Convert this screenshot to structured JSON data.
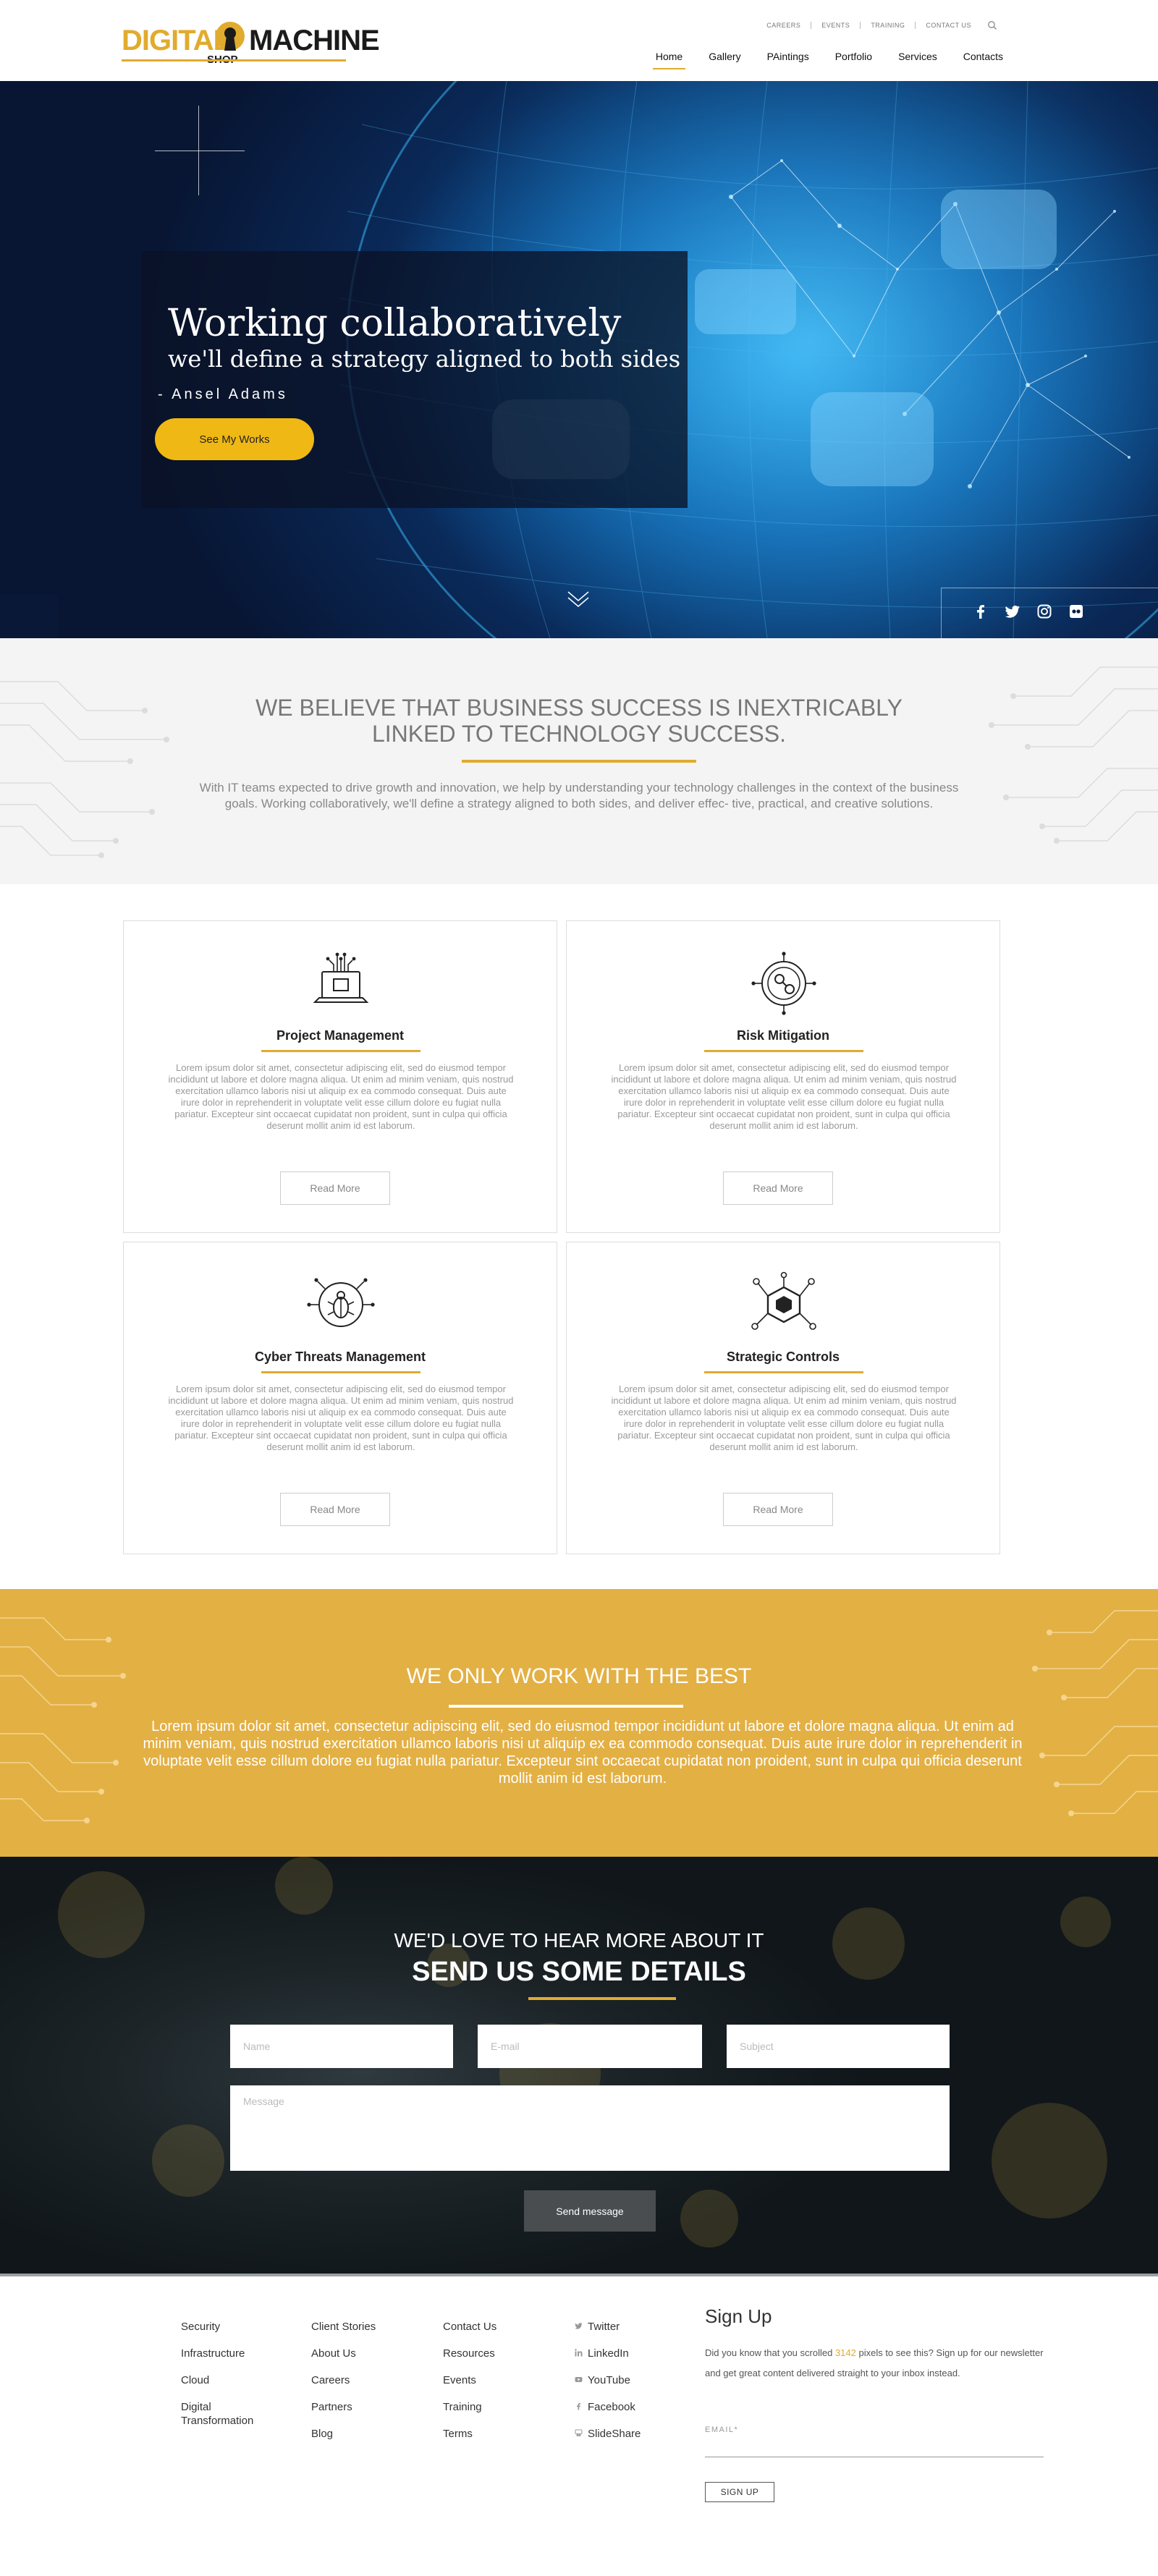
{
  "header": {
    "logo": {
      "word1": "DIGITAL",
      "word2": "MACHINE",
      "word3": "SHOP"
    },
    "util_nav": [
      "CAREERS",
      "EVENTS",
      "TRAINING",
      "CONTACT US"
    ],
    "main_nav": [
      "Home",
      "Gallery",
      "PAintings",
      "Portfolio",
      "Services",
      "Contacts"
    ],
    "active_nav": "Home",
    "accent": "#e1ab2e"
  },
  "hero": {
    "headline": "Working collaboratively",
    "subheadline": "we'll define a strategy aligned to both sides",
    "quote": "- Ansel Adams",
    "cta": "See My Works",
    "cta_color": "#f0b814",
    "social_icons": [
      "facebook-icon",
      "twitter-icon",
      "instagram-icon",
      "flickr-icon"
    ]
  },
  "believe": {
    "title": "WE BELIEVE THAT BUSINESS SUCCESS IS INEXTRICABLY LINKED TO TECHNOLOGY SUCCESS.",
    "text": "With IT teams expected to drive growth and innovation, we help by understanding your technology challenges in the context of the business goals. Working collaboratively, we'll define a strategy aligned to both sides, and deliver effec- tive, practical, and creative solutions."
  },
  "services": {
    "cards": [
      {
        "title": "Project Management",
        "icon": "laptop-circuit-icon",
        "text": "Lorem ipsum dolor sit amet, consectetur adipiscing elit, sed do eiusmod tempor incididunt ut labore et dolore magna aliqua. Ut enim ad minim veniam, quis nostrud exercitation ullamco laboris nisi ut aliquip ex ea commodo consequat. Duis aute irure dolor in reprehenderit in voluptate velit esse cillum dolore eu fugiat nulla pariatur. Excepteur sint occaecat cupidatat non proident, sunt in culpa qui officia deserunt mollit anim id est laborum.",
        "button": "Read More"
      },
      {
        "title": "Risk Mitigation",
        "icon": "network-circle-icon",
        "text": "Lorem ipsum dolor sit amet, consectetur adipiscing elit, sed do eiusmod tempor incididunt ut labore et dolore magna aliqua. Ut enim ad minim veniam, quis nostrud exercitation ullamco laboris nisi ut aliquip ex ea commodo consequat. Duis aute irure dolor in reprehenderit in voluptate velit esse cillum dolore eu fugiat nulla pariatur. Excepteur sint occaecat cupidatat non proident, sunt in culpa qui officia deserunt mollit anim id est laborum.",
        "button": "Read More"
      },
      {
        "title": "Cyber Threats Management",
        "icon": "bug-shield-icon",
        "text": "Lorem ipsum dolor sit amet, consectetur adipiscing elit, sed do eiusmod tempor incididunt ut labore et dolore magna aliqua. Ut enim ad minim veniam, quis nostrud exercitation ullamco laboris nisi ut aliquip ex ea commodo consequat. Duis aute irure dolor in reprehenderit in voluptate velit esse cillum dolore eu fugiat nulla pariatur. Excepteur sint occaecat cupidatat non proident, sunt in culpa qui officia deserunt mollit anim id est laborum.",
        "button": "Read More"
      },
      {
        "title": "Strategic Controls",
        "icon": "hexagon-network-icon",
        "text": "Lorem ipsum dolor sit amet, consectetur adipiscing elit, sed do eiusmod tempor incididunt ut labore et dolore magna aliqua. Ut enim ad minim veniam, quis nostrud exercitation ullamco laboris nisi ut aliquip ex ea commodo consequat. Duis aute irure dolor in reprehenderit in voluptate velit esse cillum dolore eu fugiat nulla pariatur. Excepteur sint occaecat cupidatat non proident, sunt in culpa qui officia deserunt mollit anim id est laborum.",
        "button": "Read More"
      }
    ]
  },
  "best": {
    "title": "WE ONLY WORK WITH THE BEST",
    "text": "Lorem ipsum dolor sit amet, consectetur adipiscing elit, sed do eiusmod tempor incididunt ut labore et dolore magna aliqua. Ut enim ad minim veniam, quis nostrud exercitation ullamco laboris nisi ut aliquip ex ea commodo consequat. Duis aute irure dolor in reprehenderit in voluptate velit esse cillum dolore eu fugiat nulla pariatur. Excepteur sint occaecat cupidatat non proident, sunt in culpa qui officia deserunt mollit anim id est laborum.",
    "bg_color": "#e3b044"
  },
  "contact": {
    "subtitle": "WE'D LOVE TO HEAR MORE ABOUT IT",
    "title": "SEND US SOME DETAILS",
    "placeholders": {
      "name": "Name",
      "email": "E-mail",
      "subject": "Subject",
      "message": "Message"
    },
    "send": "Send message"
  },
  "footer": {
    "col1": [
      "Security",
      "Infrastructure",
      "Cloud",
      "Digital Transformation"
    ],
    "col2": [
      "Client Stories",
      "About Us",
      "Careers",
      "Partners",
      "Blog"
    ],
    "col3": [
      "Contact Us",
      "Resources",
      "Events",
      "Training",
      "Terms"
    ],
    "col4": [
      {
        "label": "Twitter",
        "icon": "twitter-icon"
      },
      {
        "label": "LinkedIn",
        "icon": "linkedin-icon"
      },
      {
        "label": "YouTube",
        "icon": "youtube-icon"
      },
      {
        "label": "Facebook",
        "icon": "facebook-icon"
      },
      {
        "label": "SlideShare",
        "icon": "slideshare-icon"
      }
    ],
    "signup": {
      "title": "Sign Up",
      "text_before": "Did you know that you scrolled ",
      "scroll_count": "3142",
      "text_after": " pixels to see this? Sign up for our newsletter and get great content delivered straight to your inbox instead.",
      "email_label": "EMAIL*",
      "button": "SIGN UP"
    }
  }
}
